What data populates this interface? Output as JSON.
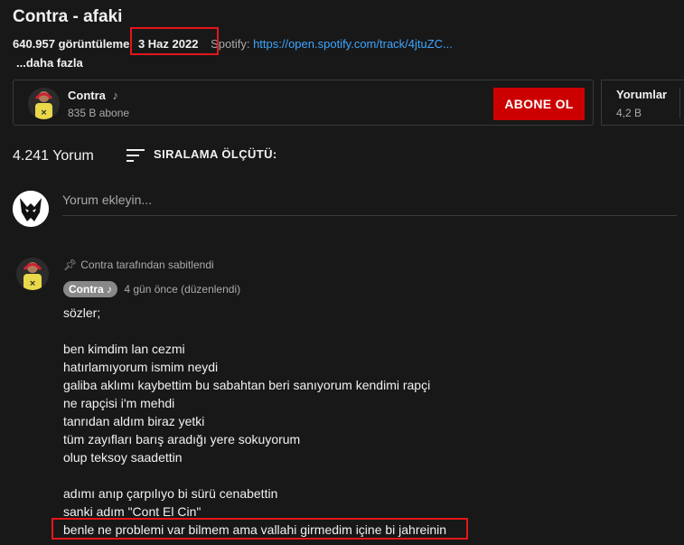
{
  "video": {
    "title": "Contra - afaki",
    "views": "640.957 görüntüleme",
    "date": "3 Haz 2022",
    "spotify_label": "Spotify:",
    "spotify_link": "https://open.spotify.com/track/4jtuZC...",
    "more": "...daha fazla"
  },
  "channel": {
    "name": "Contra",
    "music_icon": "music-note-icon",
    "subscribers": "835 B abone",
    "subscribe_label": "ABONE OL"
  },
  "side_panel": {
    "title": "Yorumlar",
    "count": "4,2 B"
  },
  "comments": {
    "count_label": "4.241 Yorum",
    "sort_label": "SIRALAMA ÖLÇÜTÜ:",
    "input_placeholder": "Yorum ekleyin..."
  },
  "pinned_comment": {
    "pinned_label": "Contra tarafından sabitlendi",
    "author": "Contra",
    "time": "4 gün önce (düzenlendi)",
    "text": "sözler;\n\nben kimdim lan cezmi\nhatırlamıyorum ismim neydi\ngaliba aklımı kaybettim bu sabahtan beri sanıyorum kendimi rapçi\nne rapçisi i'm mehdi\ntanrıdan aldım biraz yetki\ntüm zayıfları barış aradığı yere sokuyorum\nolup teksoy saadettin\n\nadımı anıp çarpılıyo bi sürü cenabettin\nsanki adım \"Cont El Cin\"\nbenle ne problemi var bilmem ama vallahi girmedim içine bi jahreinin"
  },
  "colors": {
    "background": "#181818",
    "subscribe": "#cc0000",
    "link": "#3ea6ff",
    "highlight": "#e3161a"
  }
}
